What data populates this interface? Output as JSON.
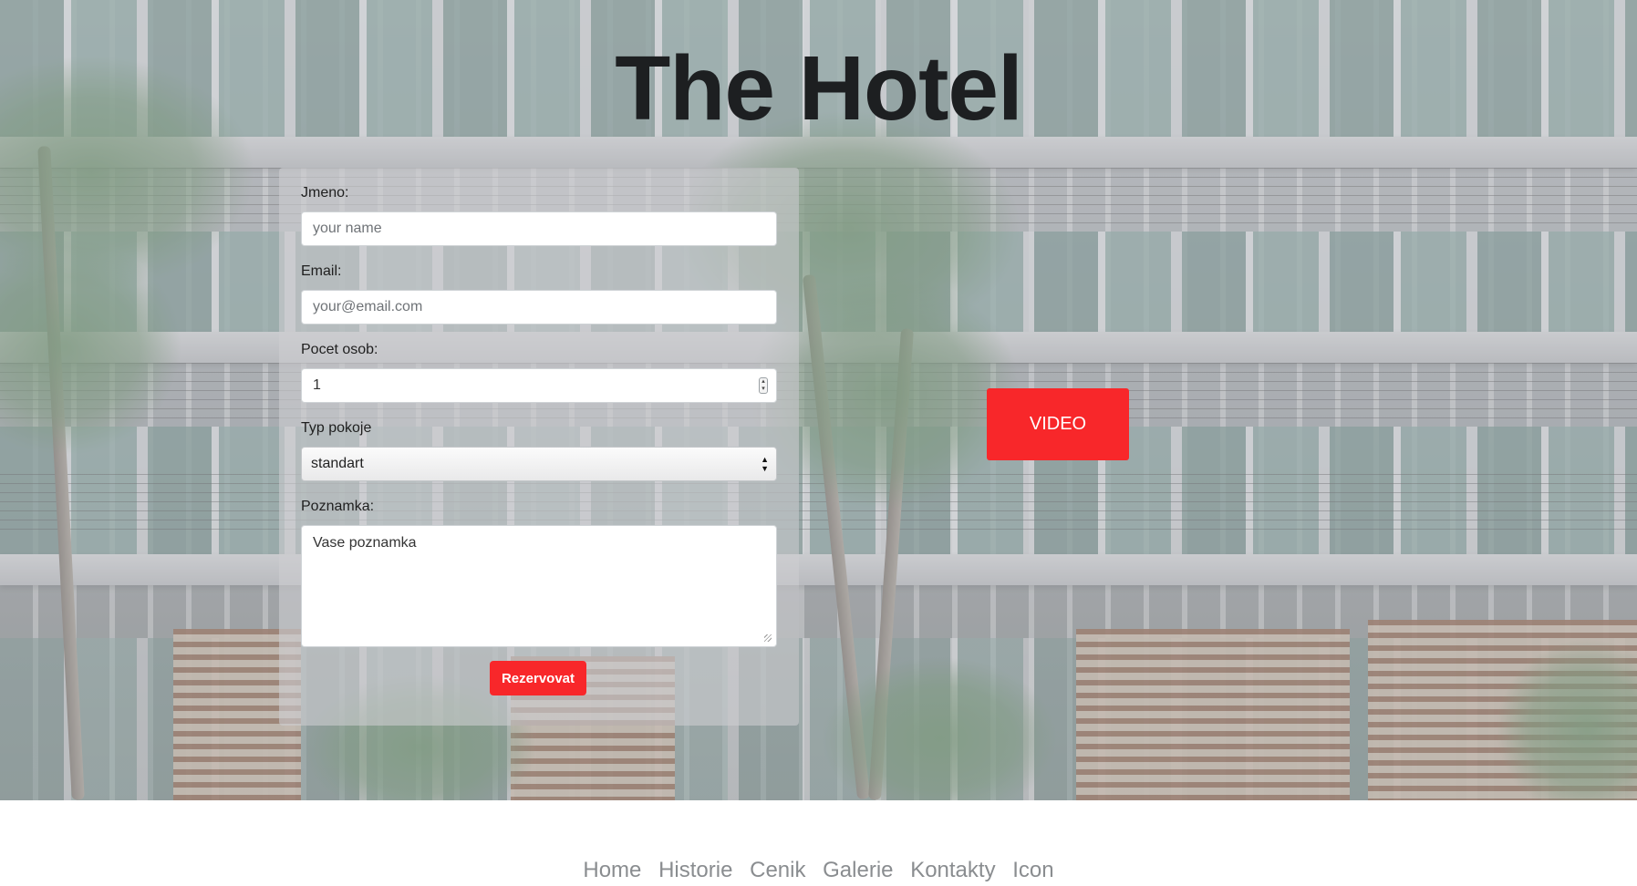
{
  "header": {
    "title": "The Hotel"
  },
  "form": {
    "name_label": "Jmeno:",
    "name_placeholder": "your name",
    "email_label": "Email:",
    "email_placeholder": "your@email.com",
    "persons_label": "Pocet osob:",
    "persons_value": "1",
    "room_label": "Typ pokoje",
    "room_value": "standart",
    "note_label": "Poznamka:",
    "note_placeholder": "Vase poznamka",
    "submit_label": "Rezervovat"
  },
  "video_button": {
    "label": "VIDEO"
  },
  "nav": {
    "items": [
      "Home",
      "Historie",
      "Cenik",
      "Galerie",
      "Kontakty",
      "Icon"
    ]
  },
  "colors": {
    "accent": "#f8272a",
    "title": "#1d1f21",
    "nav_text": "#8a8d90"
  }
}
